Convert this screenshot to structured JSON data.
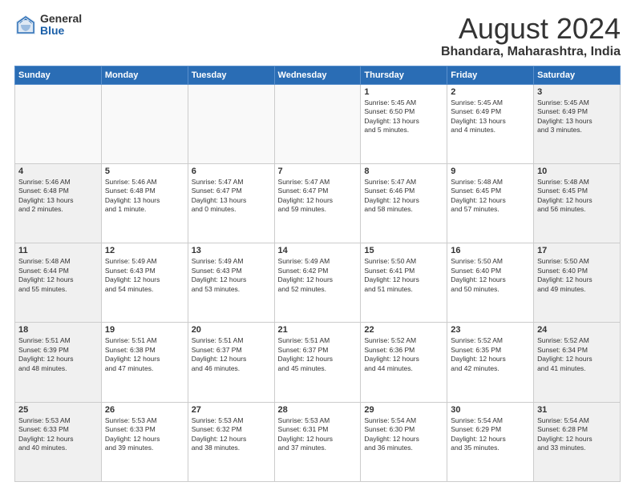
{
  "logo": {
    "general": "General",
    "blue": "Blue"
  },
  "header": {
    "month": "August 2024",
    "location": "Bhandara, Maharashtra, India"
  },
  "days_of_week": [
    "Sunday",
    "Monday",
    "Tuesday",
    "Wednesday",
    "Thursday",
    "Friday",
    "Saturday"
  ],
  "weeks": [
    [
      {
        "day": "",
        "text": "",
        "empty": true
      },
      {
        "day": "",
        "text": "",
        "empty": true
      },
      {
        "day": "",
        "text": "",
        "empty": true
      },
      {
        "day": "",
        "text": "",
        "empty": true
      },
      {
        "day": "1",
        "text": "Sunrise: 5:45 AM\nSunset: 6:50 PM\nDaylight: 13 hours\nand 5 minutes.",
        "empty": false
      },
      {
        "day": "2",
        "text": "Sunrise: 5:45 AM\nSunset: 6:49 PM\nDaylight: 13 hours\nand 4 minutes.",
        "empty": false
      },
      {
        "day": "3",
        "text": "Sunrise: 5:45 AM\nSunset: 6:49 PM\nDaylight: 13 hours\nand 3 minutes.",
        "empty": false
      }
    ],
    [
      {
        "day": "4",
        "text": "Sunrise: 5:46 AM\nSunset: 6:48 PM\nDaylight: 13 hours\nand 2 minutes.",
        "empty": false
      },
      {
        "day": "5",
        "text": "Sunrise: 5:46 AM\nSunset: 6:48 PM\nDaylight: 13 hours\nand 1 minute.",
        "empty": false
      },
      {
        "day": "6",
        "text": "Sunrise: 5:47 AM\nSunset: 6:47 PM\nDaylight: 13 hours\nand 0 minutes.",
        "empty": false
      },
      {
        "day": "7",
        "text": "Sunrise: 5:47 AM\nSunset: 6:47 PM\nDaylight: 12 hours\nand 59 minutes.",
        "empty": false
      },
      {
        "day": "8",
        "text": "Sunrise: 5:47 AM\nSunset: 6:46 PM\nDaylight: 12 hours\nand 58 minutes.",
        "empty": false
      },
      {
        "day": "9",
        "text": "Sunrise: 5:48 AM\nSunset: 6:45 PM\nDaylight: 12 hours\nand 57 minutes.",
        "empty": false
      },
      {
        "day": "10",
        "text": "Sunrise: 5:48 AM\nSunset: 6:45 PM\nDaylight: 12 hours\nand 56 minutes.",
        "empty": false
      }
    ],
    [
      {
        "day": "11",
        "text": "Sunrise: 5:48 AM\nSunset: 6:44 PM\nDaylight: 12 hours\nand 55 minutes.",
        "empty": false
      },
      {
        "day": "12",
        "text": "Sunrise: 5:49 AM\nSunset: 6:43 PM\nDaylight: 12 hours\nand 54 minutes.",
        "empty": false
      },
      {
        "day": "13",
        "text": "Sunrise: 5:49 AM\nSunset: 6:43 PM\nDaylight: 12 hours\nand 53 minutes.",
        "empty": false
      },
      {
        "day": "14",
        "text": "Sunrise: 5:49 AM\nSunset: 6:42 PM\nDaylight: 12 hours\nand 52 minutes.",
        "empty": false
      },
      {
        "day": "15",
        "text": "Sunrise: 5:50 AM\nSunset: 6:41 PM\nDaylight: 12 hours\nand 51 minutes.",
        "empty": false
      },
      {
        "day": "16",
        "text": "Sunrise: 5:50 AM\nSunset: 6:40 PM\nDaylight: 12 hours\nand 50 minutes.",
        "empty": false
      },
      {
        "day": "17",
        "text": "Sunrise: 5:50 AM\nSunset: 6:40 PM\nDaylight: 12 hours\nand 49 minutes.",
        "empty": false
      }
    ],
    [
      {
        "day": "18",
        "text": "Sunrise: 5:51 AM\nSunset: 6:39 PM\nDaylight: 12 hours\nand 48 minutes.",
        "empty": false
      },
      {
        "day": "19",
        "text": "Sunrise: 5:51 AM\nSunset: 6:38 PM\nDaylight: 12 hours\nand 47 minutes.",
        "empty": false
      },
      {
        "day": "20",
        "text": "Sunrise: 5:51 AM\nSunset: 6:37 PM\nDaylight: 12 hours\nand 46 minutes.",
        "empty": false
      },
      {
        "day": "21",
        "text": "Sunrise: 5:51 AM\nSunset: 6:37 PM\nDaylight: 12 hours\nand 45 minutes.",
        "empty": false
      },
      {
        "day": "22",
        "text": "Sunrise: 5:52 AM\nSunset: 6:36 PM\nDaylight: 12 hours\nand 44 minutes.",
        "empty": false
      },
      {
        "day": "23",
        "text": "Sunrise: 5:52 AM\nSunset: 6:35 PM\nDaylight: 12 hours\nand 42 minutes.",
        "empty": false
      },
      {
        "day": "24",
        "text": "Sunrise: 5:52 AM\nSunset: 6:34 PM\nDaylight: 12 hours\nand 41 minutes.",
        "empty": false
      }
    ],
    [
      {
        "day": "25",
        "text": "Sunrise: 5:53 AM\nSunset: 6:33 PM\nDaylight: 12 hours\nand 40 minutes.",
        "empty": false
      },
      {
        "day": "26",
        "text": "Sunrise: 5:53 AM\nSunset: 6:33 PM\nDaylight: 12 hours\nand 39 minutes.",
        "empty": false
      },
      {
        "day": "27",
        "text": "Sunrise: 5:53 AM\nSunset: 6:32 PM\nDaylight: 12 hours\nand 38 minutes.",
        "empty": false
      },
      {
        "day": "28",
        "text": "Sunrise: 5:53 AM\nSunset: 6:31 PM\nDaylight: 12 hours\nand 37 minutes.",
        "empty": false
      },
      {
        "day": "29",
        "text": "Sunrise: 5:54 AM\nSunset: 6:30 PM\nDaylight: 12 hours\nand 36 minutes.",
        "empty": false
      },
      {
        "day": "30",
        "text": "Sunrise: 5:54 AM\nSunset: 6:29 PM\nDaylight: 12 hours\nand 35 minutes.",
        "empty": false
      },
      {
        "day": "31",
        "text": "Sunrise: 5:54 AM\nSunset: 6:28 PM\nDaylight: 12 hours\nand 33 minutes.",
        "empty": false
      }
    ]
  ]
}
